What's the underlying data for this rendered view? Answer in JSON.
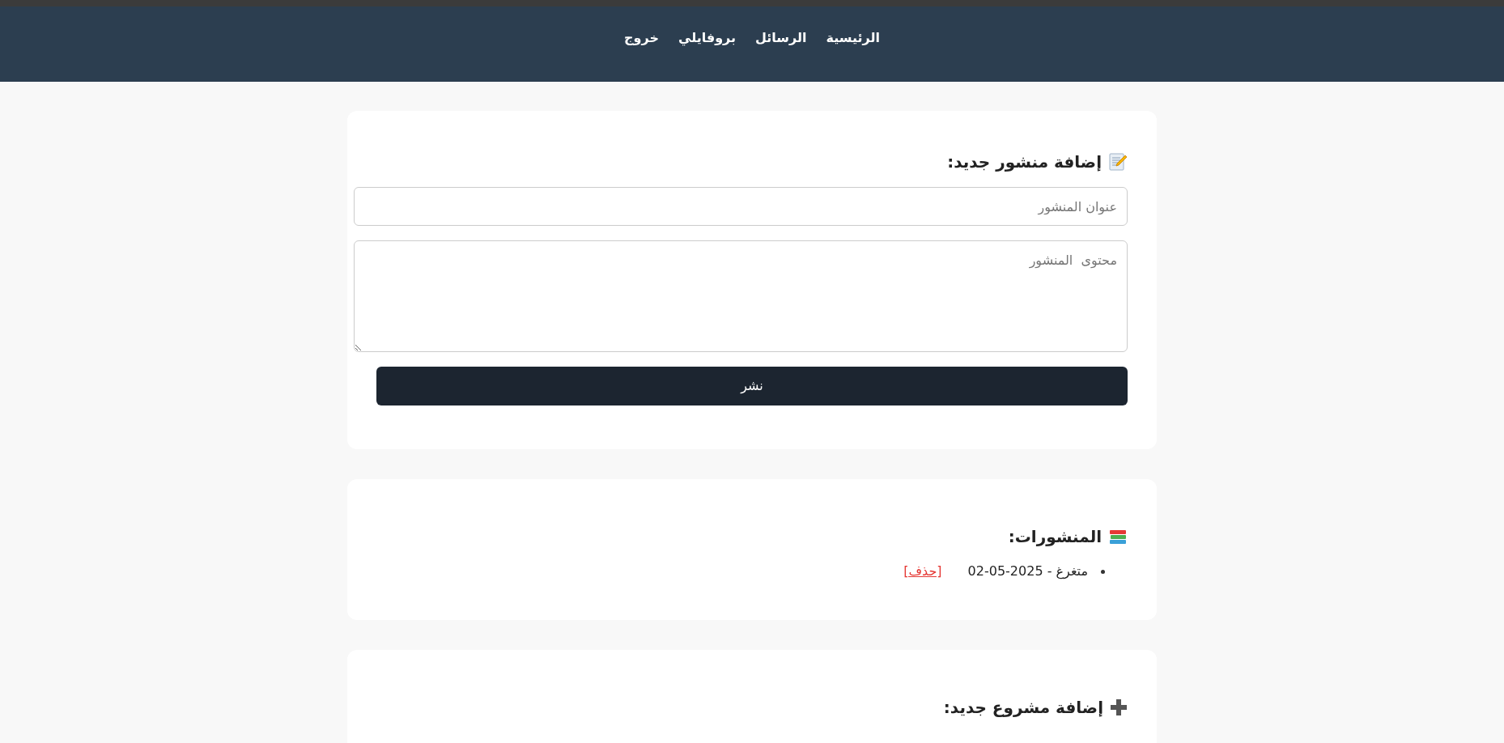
{
  "nav": {
    "links": [
      {
        "label": "الرئيسية"
      },
      {
        "label": "الرسائل"
      },
      {
        "label": "بروفايلي"
      },
      {
        "label": "خروج"
      }
    ]
  },
  "new_post": {
    "heading": "إضافة منشور جديد:",
    "title_placeholder": "عنوان المنشور",
    "content_placeholder": "محتوى  المنشور",
    "submit": "نشر"
  },
  "posts": {
    "heading": "المنشورات:",
    "items": [
      {
        "text": "متغرغ - 2025-05-02",
        "delete": "[حذف]"
      }
    ]
  },
  "new_project": {
    "heading": "إضافة مشروع جديد:"
  }
}
